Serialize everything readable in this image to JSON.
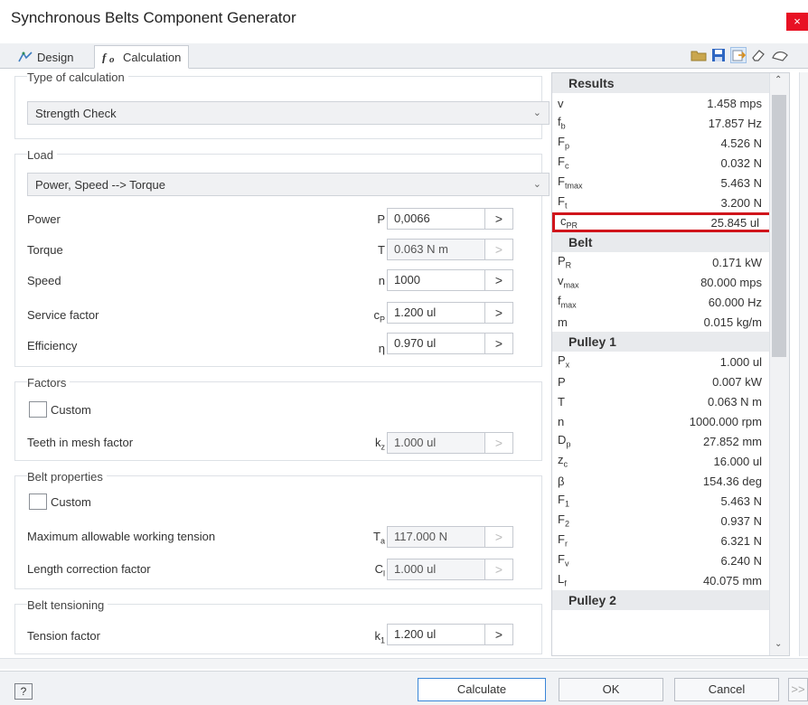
{
  "window": {
    "title": "Synchronous Belts Component Generator",
    "close_glyph": "×"
  },
  "tabs": [
    {
      "label": "Design",
      "icon": "design-icon"
    },
    {
      "label": "Calculation",
      "icon": "calculation-icon"
    }
  ],
  "toolbar_icons": [
    "open-folder-icon",
    "save-icon",
    "export-icon",
    "eraser-icon",
    "options-icon"
  ],
  "calc_type": {
    "heading": "Type of calculation",
    "selected": "Strength Check"
  },
  "load": {
    "heading": "Load",
    "selected": "Power, Speed --> Torque",
    "rows": [
      {
        "label": "Power",
        "symbol": "P",
        "value": "0,0066",
        "arrow": ">",
        "enabled": true
      },
      {
        "label": "Torque",
        "symbol": "T",
        "value": "0.063 N m",
        "arrow": ">",
        "enabled": false
      },
      {
        "label": "Speed",
        "symbol": "n",
        "value": "1000",
        "arrow": ">",
        "enabled": true
      },
      {
        "label": "Service factor",
        "symbol": "cP",
        "symbol_main": "c",
        "symbol_sub": "P",
        "value": "1.200 ul",
        "arrow": ">",
        "enabled": true
      },
      {
        "label": "Efficiency",
        "symbol": "η",
        "value": "0.970 ul",
        "arrow": ">",
        "enabled": true
      }
    ]
  },
  "factors": {
    "heading": "Factors",
    "custom_label": "Custom",
    "rows": [
      {
        "label": "Teeth in mesh factor",
        "symbol_main": "k",
        "symbol_sub": "z",
        "value": "1.000 ul",
        "arrow": ">",
        "enabled": false
      }
    ]
  },
  "belt_properties": {
    "heading": "Belt properties",
    "custom_label": "Custom",
    "rows": [
      {
        "label": "Maximum allowable working tension",
        "symbol_main": "T",
        "symbol_sub": "a",
        "value": "117.000 N",
        "arrow": ">",
        "enabled": false
      },
      {
        "label": "Length correction factor",
        "symbol_main": "C",
        "symbol_sub": "l",
        "value": "1.000 ul",
        "arrow": ">",
        "enabled": false
      }
    ]
  },
  "belt_tensioning": {
    "heading": "Belt tensioning",
    "rows": [
      {
        "label": "Tension factor",
        "symbol_main": "k",
        "symbol_sub": "1",
        "value": "1.200 ul",
        "arrow": ">",
        "enabled": true
      }
    ]
  },
  "results": {
    "heading": "Results",
    "rows": [
      {
        "sym": "v",
        "sub": "",
        "value": "1.458 mps"
      },
      {
        "sym": "f",
        "sub": "b",
        "value": "17.857 Hz"
      },
      {
        "sym": "F",
        "sub": "p",
        "value": "4.526 N"
      },
      {
        "sym": "F",
        "sub": "c",
        "value": "0.032 N"
      },
      {
        "sym": "F",
        "sub": "tmax",
        "value": "5.463 N"
      },
      {
        "sym": "F",
        "sub": "t",
        "value": "3.200 N"
      },
      {
        "sym": "c",
        "sub": "PR",
        "value": "25.845 ul",
        "highlight": true
      },
      {
        "section": "Belt"
      },
      {
        "sym": "P",
        "sub": "R",
        "value": "0.171 kW"
      },
      {
        "sym": "v",
        "sub": "max",
        "value": "80.000 mps"
      },
      {
        "sym": "f",
        "sub": "max",
        "value": "60.000 Hz"
      },
      {
        "sym": "m",
        "sub": "",
        "value": "0.015 kg/m"
      },
      {
        "section": "Pulley 1"
      },
      {
        "sym": "P",
        "sub": "x",
        "value": "1.000 ul"
      },
      {
        "sym": "P",
        "sub": "",
        "value": "0.007 kW"
      },
      {
        "sym": "T",
        "sub": "",
        "value": "0.063 N m"
      },
      {
        "sym": "n",
        "sub": "",
        "value": "1000.000 rpm"
      },
      {
        "sym": "D",
        "sub": "p",
        "value": "27.852 mm"
      },
      {
        "sym": "z",
        "sub": "c",
        "value": "16.000 ul"
      },
      {
        "sym": "β",
        "sub": "",
        "value": "154.36 deg"
      },
      {
        "sym": "F",
        "sub": "1",
        "value": "5.463 N"
      },
      {
        "sym": "F",
        "sub": "2",
        "value": "0.937 N"
      },
      {
        "sym": "F",
        "sub": "r",
        "value": "6.321 N"
      },
      {
        "sym": "F",
        "sub": "v",
        "value": "6.240 N"
      },
      {
        "sym": "L",
        "sub": "f",
        "value": "40.075 mm"
      },
      {
        "section": "Pulley 2"
      }
    ]
  },
  "footer": {
    "help_label": "?",
    "calculate_label": "Calculate",
    "ok_label": "OK",
    "cancel_label": "Cancel",
    "more_label": ">>"
  },
  "colors": {
    "highlight": "#d0141b",
    "primary_border": "#3a86d8"
  }
}
